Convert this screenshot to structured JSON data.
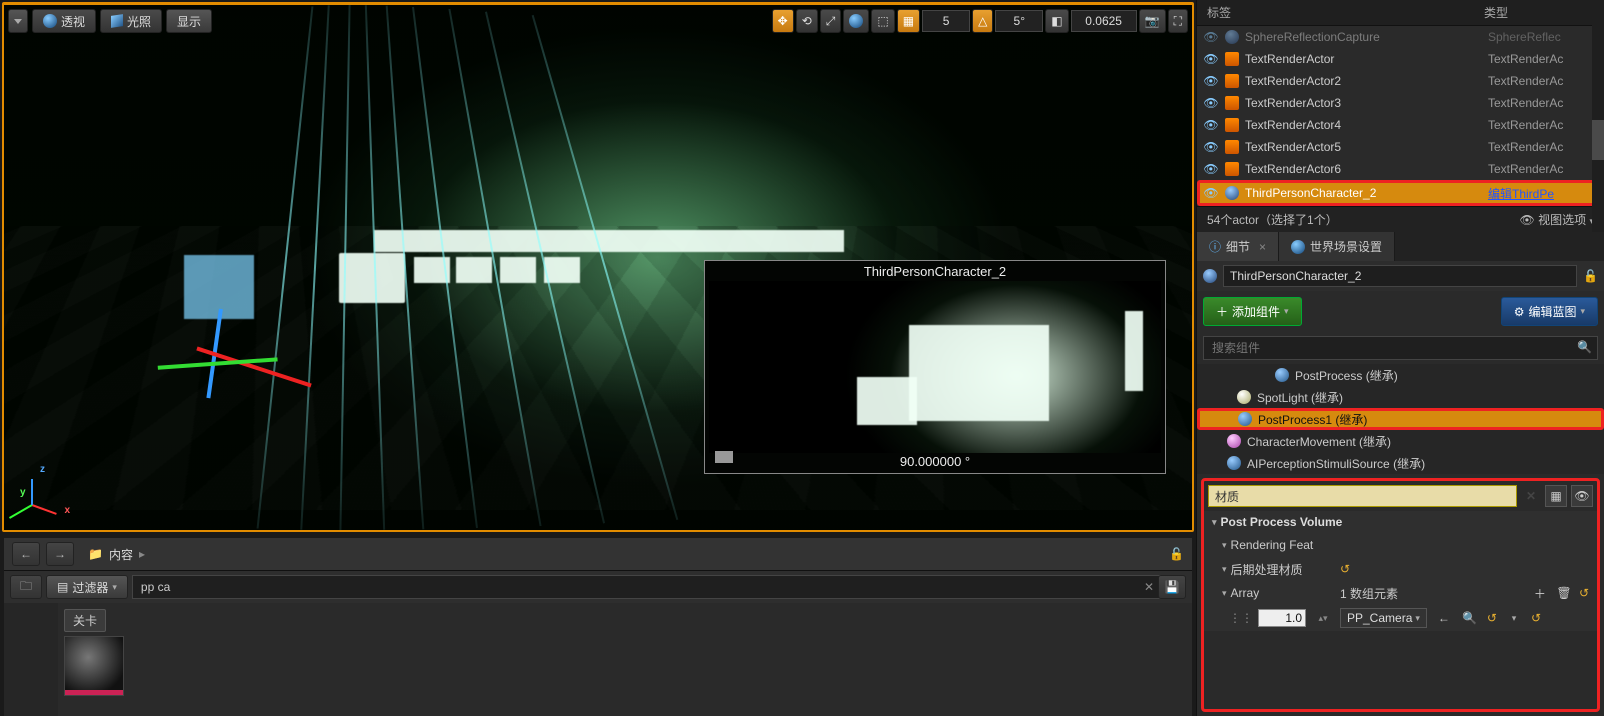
{
  "viewport": {
    "perspective": "透视",
    "light": "光照",
    "show": "显示",
    "snap_grid": "5",
    "snap_angle": "5°",
    "snap_scale": "0.0625",
    "preview_title": "ThirdPersonCharacter_2",
    "preview_deg": "90.000000 °"
  },
  "outliner": {
    "col_label": "标签",
    "col_type": "类型",
    "rows": [
      {
        "label": "SphereReflectionCapture",
        "type": "SphereReflec"
      },
      {
        "label": "TextRenderActor",
        "type": "TextRenderAc"
      },
      {
        "label": "TextRenderActor2",
        "type": "TextRenderAc"
      },
      {
        "label": "TextRenderActor3",
        "type": "TextRenderAc"
      },
      {
        "label": "TextRenderActor4",
        "type": "TextRenderAc"
      },
      {
        "label": "TextRenderActor5",
        "type": "TextRenderAc"
      },
      {
        "label": "TextRenderActor6",
        "type": "TextRenderAc"
      },
      {
        "label": "ThirdPersonCharacter_2",
        "type": "编辑ThirdPe"
      }
    ],
    "status_count": "54个actor（选择了1个）",
    "status_view": "视图选项"
  },
  "details": {
    "tab_details": "细节",
    "tab_world": "世界场景设置",
    "selected_name": "ThirdPersonCharacter_2",
    "btn_add_component": "添加组件",
    "btn_edit_blueprint": "编辑蓝图",
    "search_placeholder": "搜索组件",
    "components": {
      "postprocess": "PostProcess (继承)",
      "spotlight": "SpotLight (继承)",
      "postprocess1": "PostProcess1 (继承)",
      "charmove": "CharacterMovement (继承)",
      "aiperception": "AIPerceptionStimuliSource (继承)"
    },
    "prop_search_value": "材质",
    "cat_ppv": "Post Process Volume",
    "cat_rendering": "Rendering Feat",
    "prop_post_material": "后期处理材质",
    "prop_array": "Array",
    "array_count": "1 数组元素",
    "array_weight": "1.0",
    "array_asset": "PP_Camera"
  },
  "content_browser": {
    "breadcrumb": "内容",
    "filter_label": "过滤器",
    "search_value": "pp ca",
    "folder_chip": "关卡"
  }
}
